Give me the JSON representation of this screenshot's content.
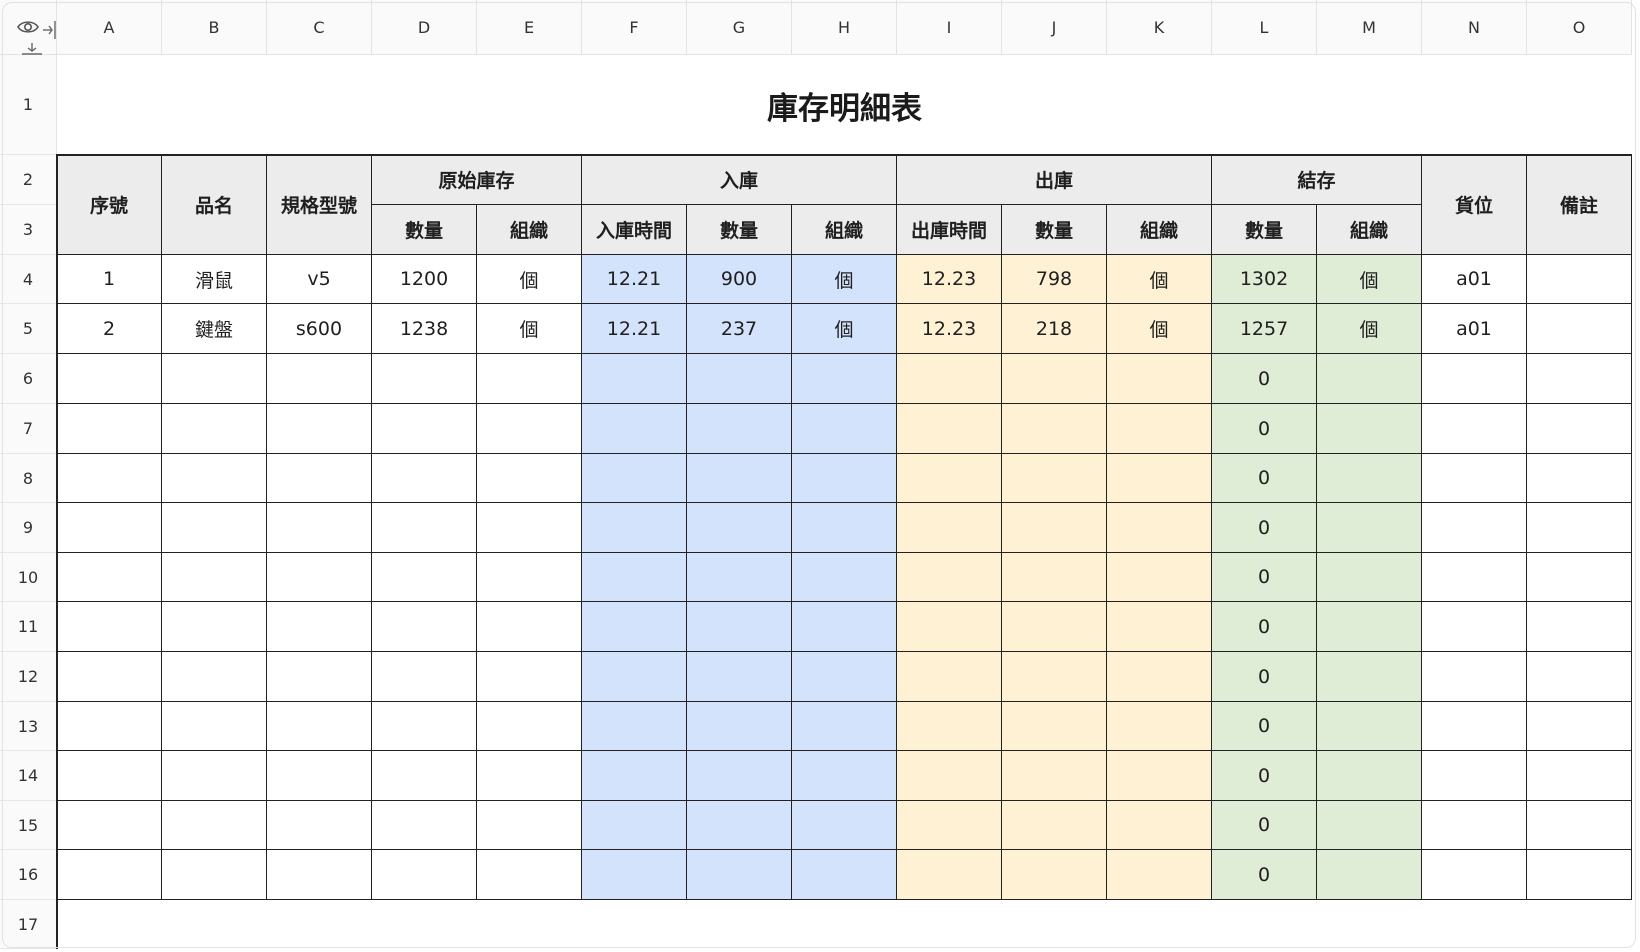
{
  "columns": [
    "A",
    "B",
    "C",
    "D",
    "E",
    "F",
    "G",
    "H",
    "I",
    "J",
    "K",
    "L",
    "M",
    "N",
    "O"
  ],
  "rows": [
    "1",
    "2",
    "3",
    "4",
    "5",
    "6",
    "7",
    "8",
    "9",
    "10",
    "11",
    "12",
    "13",
    "14",
    "15",
    "16",
    "17"
  ],
  "title": "庫存明細表",
  "header": {
    "seq": "序號",
    "name": "品名",
    "spec": "規格型號",
    "original_stock": "原始庫存",
    "inbound": "入庫",
    "outbound": "出庫",
    "balance": "結存",
    "location": "貨位",
    "remark": "備註",
    "qty": "數量",
    "unit": "組織",
    "in_time": "入庫時間",
    "out_time": "出庫時間"
  },
  "records": [
    [
      "1",
      "滑鼠",
      "v5",
      "1200",
      "個",
      "12.21",
      "900",
      "個",
      "12.23",
      "798",
      "個",
      "1302",
      "個",
      "a01",
      ""
    ],
    [
      "2",
      "鍵盤",
      "s600",
      "1238",
      "個",
      "12.21",
      "237",
      "個",
      "12.23",
      "218",
      "個",
      "1257",
      "個",
      "a01",
      ""
    ],
    [
      "",
      "",
      "",
      "",
      "",
      "",
      "",
      "",
      "",
      "",
      "",
      "0",
      "",
      "",
      ""
    ],
    [
      "",
      "",
      "",
      "",
      "",
      "",
      "",
      "",
      "",
      "",
      "",
      "0",
      "",
      "",
      ""
    ],
    [
      "",
      "",
      "",
      "",
      "",
      "",
      "",
      "",
      "",
      "",
      "",
      "0",
      "",
      "",
      ""
    ],
    [
      "",
      "",
      "",
      "",
      "",
      "",
      "",
      "",
      "",
      "",
      "",
      "0",
      "",
      "",
      ""
    ],
    [
      "",
      "",
      "",
      "",
      "",
      "",
      "",
      "",
      "",
      "",
      "",
      "0",
      "",
      "",
      ""
    ],
    [
      "",
      "",
      "",
      "",
      "",
      "",
      "",
      "",
      "",
      "",
      "",
      "0",
      "",
      "",
      ""
    ],
    [
      "",
      "",
      "",
      "",
      "",
      "",
      "",
      "",
      "",
      "",
      "",
      "0",
      "",
      "",
      ""
    ],
    [
      "",
      "",
      "",
      "",
      "",
      "",
      "",
      "",
      "",
      "",
      "",
      "0",
      "",
      "",
      ""
    ],
    [
      "",
      "",
      "",
      "",
      "",
      "",
      "",
      "",
      "",
      "",
      "",
      "0",
      "",
      "",
      ""
    ],
    [
      "",
      "",
      "",
      "",
      "",
      "",
      "",
      "",
      "",
      "",
      "",
      "0",
      "",
      "",
      ""
    ],
    [
      "",
      "",
      "",
      "",
      "",
      "",
      "",
      "",
      "",
      "",
      "",
      "0",
      "",
      "",
      ""
    ]
  ],
  "colors": {
    "header_bg": "#ececec",
    "inbound_bg": "#d4e3fc",
    "outbound_bg": "#fef1d4",
    "balance_bg": "#dfedd6",
    "plain_bg": "#ffffff"
  },
  "icons": {
    "visibility": "eye-icon",
    "freeze_columns": "freeze-columns-icon",
    "freeze_rows": "freeze-rows-icon"
  }
}
